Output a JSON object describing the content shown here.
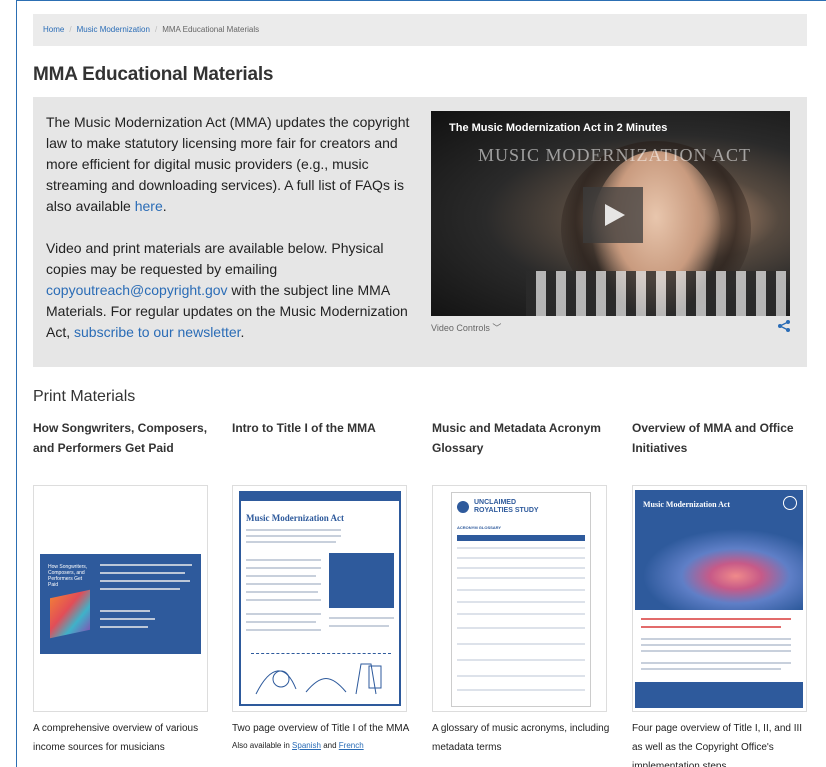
{
  "breadcrumb": [
    "Home",
    "Music Modernization",
    "MMA Educational Materials"
  ],
  "page_title": "MMA Educational Materials",
  "intro": {
    "p1_text": "The Music Modernization Act (MMA) updates the copyright law to make statutory licensing more fair for creators and more efficient for digital music providers (e.g., music streaming and downloading services). A full list of FAQs is also available ",
    "p1_link": "here",
    "p1_end": ".",
    "p2_text": "Video and print materials are available below. Physical copies may be requested by emailing ",
    "p2_email": "copyoutreach@copyright.gov",
    "p2_mid": " with the subject line MMA Materials. For regular updates on the Music Modernization Act, ",
    "p2_link": "subscribe to our newsletter",
    "p2_end": "."
  },
  "video": {
    "title": "The Music Modernization Act in 2 Minutes",
    "banner": "MUSIC MODERNIZATION ACT",
    "controls_label": "Video Controls"
  },
  "print_heading": "Print Materials",
  "materials": [
    {
      "title": "How Songwriters, Composers, and Performers Get Paid",
      "desc": "A comprehensive overview of various income sources for musicians"
    },
    {
      "title": "Intro to Title I of the MMA",
      "desc": "Two page overview of Title I of the MMA",
      "extra_prefix": "Also available in ",
      "extra_link1": "Spanish",
      "extra_mid": " and ",
      "extra_link2": "French"
    },
    {
      "title": "Music and Metadata Acronym Glossary",
      "desc": "A glossary of music acronyms, including metadata terms"
    },
    {
      "title": "Overview of MMA and Office Initiatives",
      "desc": "Four page overview of Title I, II, and III as well as the Copyright Office's implementation steps"
    }
  ],
  "thumb_text": {
    "t1_heading": "How Songwriters, Composers, and Performers Get Paid",
    "t2_heading": "Music Modernization Act",
    "t3_heading": "UNCLAIMED ROYALTIES STUDY",
    "t3_sub": "ACRONYM GLOSSARY",
    "t4_heading": "Music Modernization Act"
  },
  "colors": {
    "link": "#2a6cb6",
    "panel": "#e6e6e6",
    "doc_blue": "#2e5a9c"
  }
}
